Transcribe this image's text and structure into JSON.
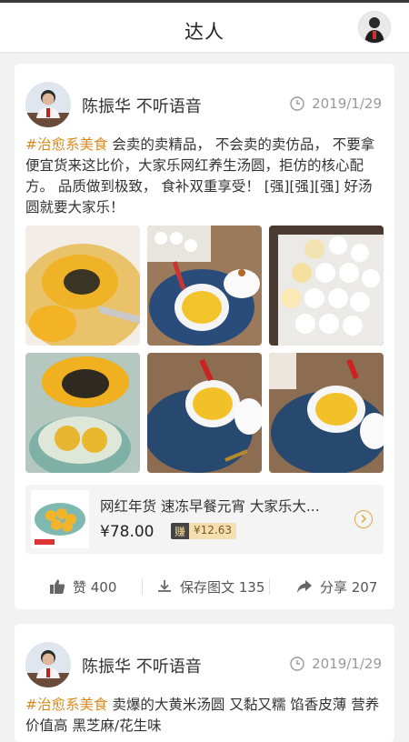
{
  "header": {
    "title": "达人"
  },
  "posts": [
    {
      "author": "陈振华 不听语音",
      "date": "2019/1/29",
      "hashtag": "#治愈系美食",
      "body": " 会卖的卖精品， 不会卖的卖仿品， 不要拿便宜货来这比价，大家乐网红养生汤圆，拒仿的核心配方。 品质做到极致， 食补双重享受！ [强][强][强] 好汤圆就要大家乐！",
      "product": {
        "title": "网红年货 速冻早餐元宵 大家乐大...",
        "price": "¥78.00",
        "earn_label": "赚",
        "earn_amount": "¥12.63"
      },
      "actions": {
        "like": "赞 400",
        "save": "保存图文 135",
        "share": "分享 207"
      }
    },
    {
      "author": "陈振华 不听语音",
      "date": "2019/1/29",
      "hashtag": "#治愈系美食",
      "body": " 卖爆的大黄米汤圆 又黏又糯 馅香皮薄 营养价值高 黑芝麻/花生味"
    }
  ],
  "icons": {
    "clock": "clock-icon",
    "like": "thumbs-up-icon",
    "save": "download-icon",
    "share": "share-icon",
    "chevron": "chevron-right-icon"
  },
  "colors": {
    "hashtag": "#d98a1f",
    "earn_badge": "#f5deb0"
  }
}
